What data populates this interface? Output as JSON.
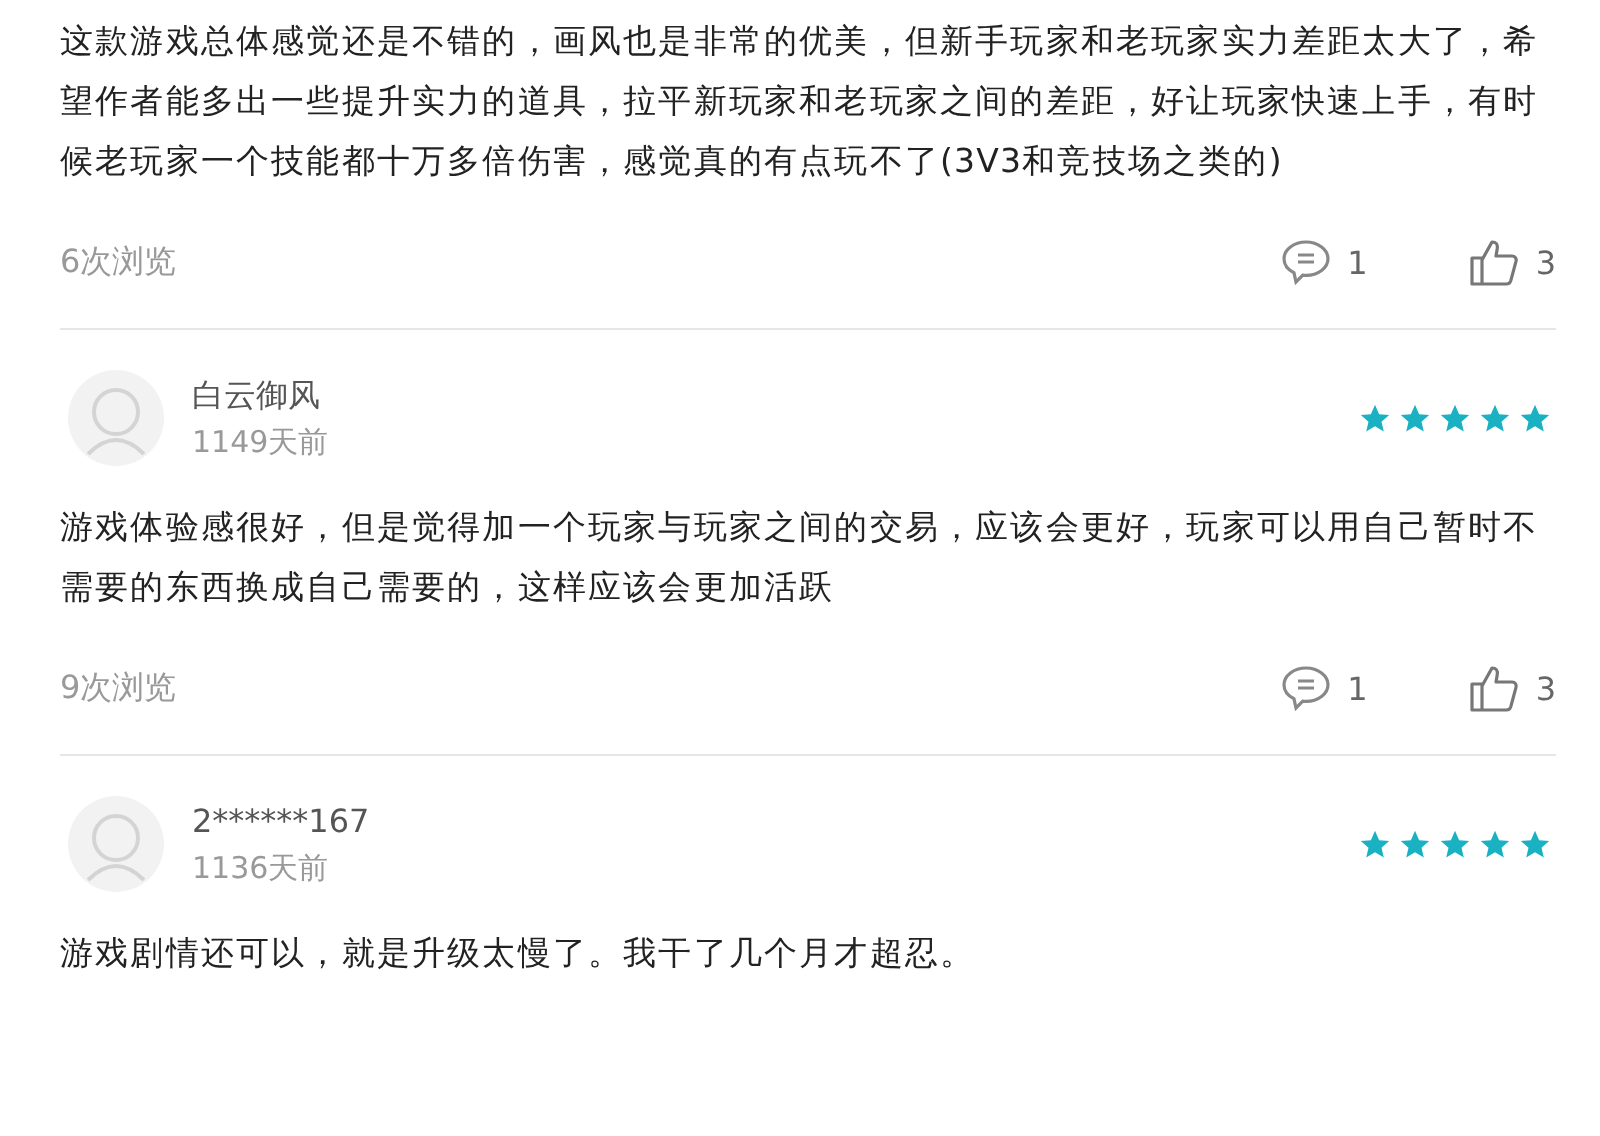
{
  "reviews": [
    {
      "text": "这款游戏总体感觉还是不错的，画风也是非常的优美，但新手玩家和老玩家实力差距太大了，希望作者能多出一些提升实力的道具，拉平新玩家和老玩家之间的差距，好让玩家快速上手，有时候老玩家一个技能都十万多倍伤害，感觉真的有点玩不了(3V3和竞技场之类的)",
      "views": "6次浏览",
      "comments": "1",
      "likes": "3"
    },
    {
      "user": {
        "name": "白云御风",
        "date": "1149天前"
      },
      "stars": 5,
      "text": "游戏体验感很好，但是觉得加一个玩家与玩家之间的交易，应该会更好，玩家可以用自己暂时不需要的东西换成自己需要的，这样应该会更加活跃",
      "views": "9次浏览",
      "comments": "1",
      "likes": "3"
    },
    {
      "user": {
        "name": "2******167",
        "date": "1136天前"
      },
      "stars": 5,
      "text": "游戏剧情还可以，就是升级太慢了。我干了几个月才超忍。"
    }
  ]
}
